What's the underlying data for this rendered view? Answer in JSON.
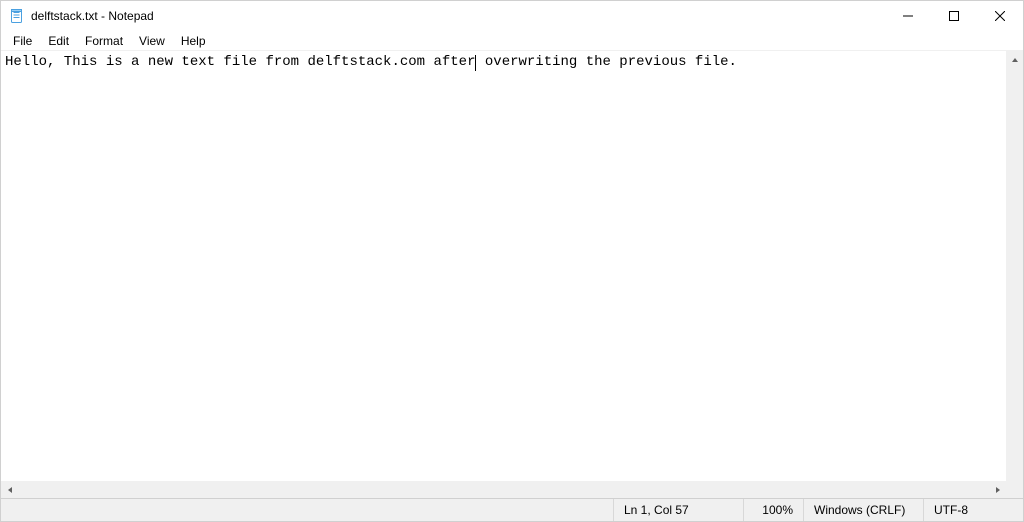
{
  "titlebar": {
    "title": "delftstack.txt - Notepad"
  },
  "menu": {
    "file": "File",
    "edit": "Edit",
    "format": "Format",
    "view": "View",
    "help": "Help"
  },
  "editor": {
    "text_before_cursor": "Hello, This is a new text file from delftstack.com after",
    "text_after_cursor": " overwriting the previous file."
  },
  "status": {
    "position": "Ln 1, Col 57",
    "zoom": "100%",
    "eol": "Windows (CRLF)",
    "encoding": "UTF-8"
  }
}
